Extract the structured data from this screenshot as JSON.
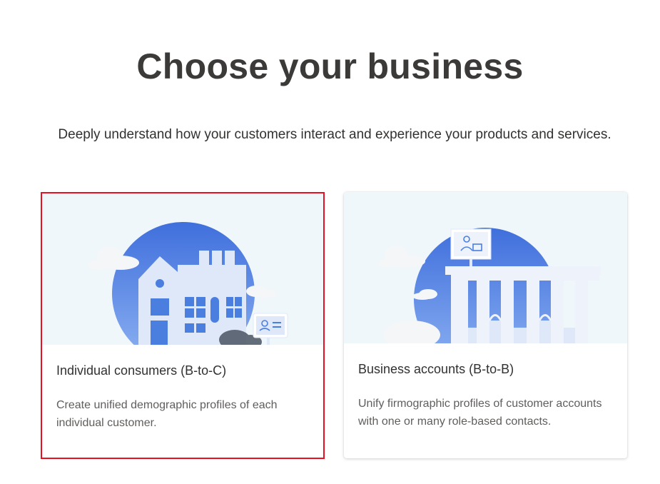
{
  "page": {
    "title": "Choose your business",
    "subtitle": "Deeply understand how your customers interact and experience your products and services."
  },
  "cards": [
    {
      "title": "Individual consumers (B-to-C)",
      "description": "Create unified demographic profiles of each individual customer.",
      "selected": true,
      "illustration": "house-icon"
    },
    {
      "title": "Business accounts (B-to-B)",
      "description": "Unify firmographic profiles of customer accounts with one or many role-based contacts.",
      "selected": false,
      "illustration": "building-icon"
    }
  ],
  "colors": {
    "selection_border": "#e81123",
    "accent_blue": "#4a7fe0",
    "illustration_bg": "#f0f7fa"
  }
}
